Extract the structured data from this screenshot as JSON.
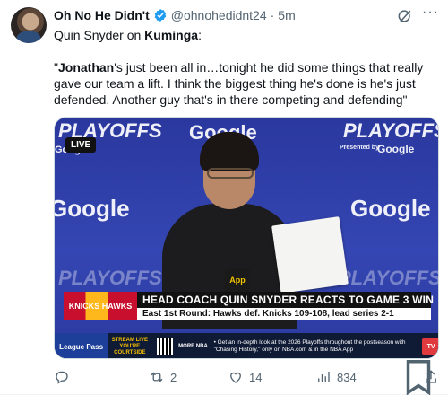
{
  "author": {
    "display_name": "Oh No He Didn't",
    "handle": "@ohnohedidnt24",
    "separator": "·",
    "time": "5m"
  },
  "post": {
    "intro_text": "Quin Snyder on ",
    "intro_bold": "Kuminga",
    "intro_end": ":",
    "quote_open": "\"",
    "quote_bold": "Jonathan",
    "quote_rest": "'s just been all in…tonight he did some things that really gave our team a lift. I think the biggest thing he's done is he's just defended. Another guy that's in there competing and defending\""
  },
  "video": {
    "live_badge": "LIVE",
    "wall_text": {
      "playoffs_left": "PLAYOFFS",
      "playoffs_right": "PLAYOFFS",
      "presented_by": "Presented by",
      "google": "Google",
      "playoffs_bottom_left": "PLAYOFFS",
      "playoffs_bottom_right": "PLAYOFFS"
    },
    "mic_label": "App",
    "lower_third": {
      "tag": "KNICKS HAWKS",
      "headline": "HEAD COACH QUIN SNYDER REACTS TO GAME 3 WIN",
      "subline": "East 1st Round: Hawks def. Knicks 109-108, lead series 2-1"
    },
    "ticker": {
      "league_pass": "League Pass",
      "stream": "STREAM LIVE YOU'RE COURTSIDE",
      "more_nba": "MORE NBA",
      "info": "• Get an in-depth look at the 2026 Playoffs throughout the postseason with \"Chasing History,\" only on NBA.com & in the NBA App",
      "tv": "TV"
    }
  },
  "actions": {
    "reply_count": "",
    "repost_count": "2",
    "like_count": "14",
    "views_count": "834"
  },
  "colors": {
    "verified": "#1d9bf0",
    "muted": "#536471",
    "wall_blue": "#2f3ea0"
  }
}
